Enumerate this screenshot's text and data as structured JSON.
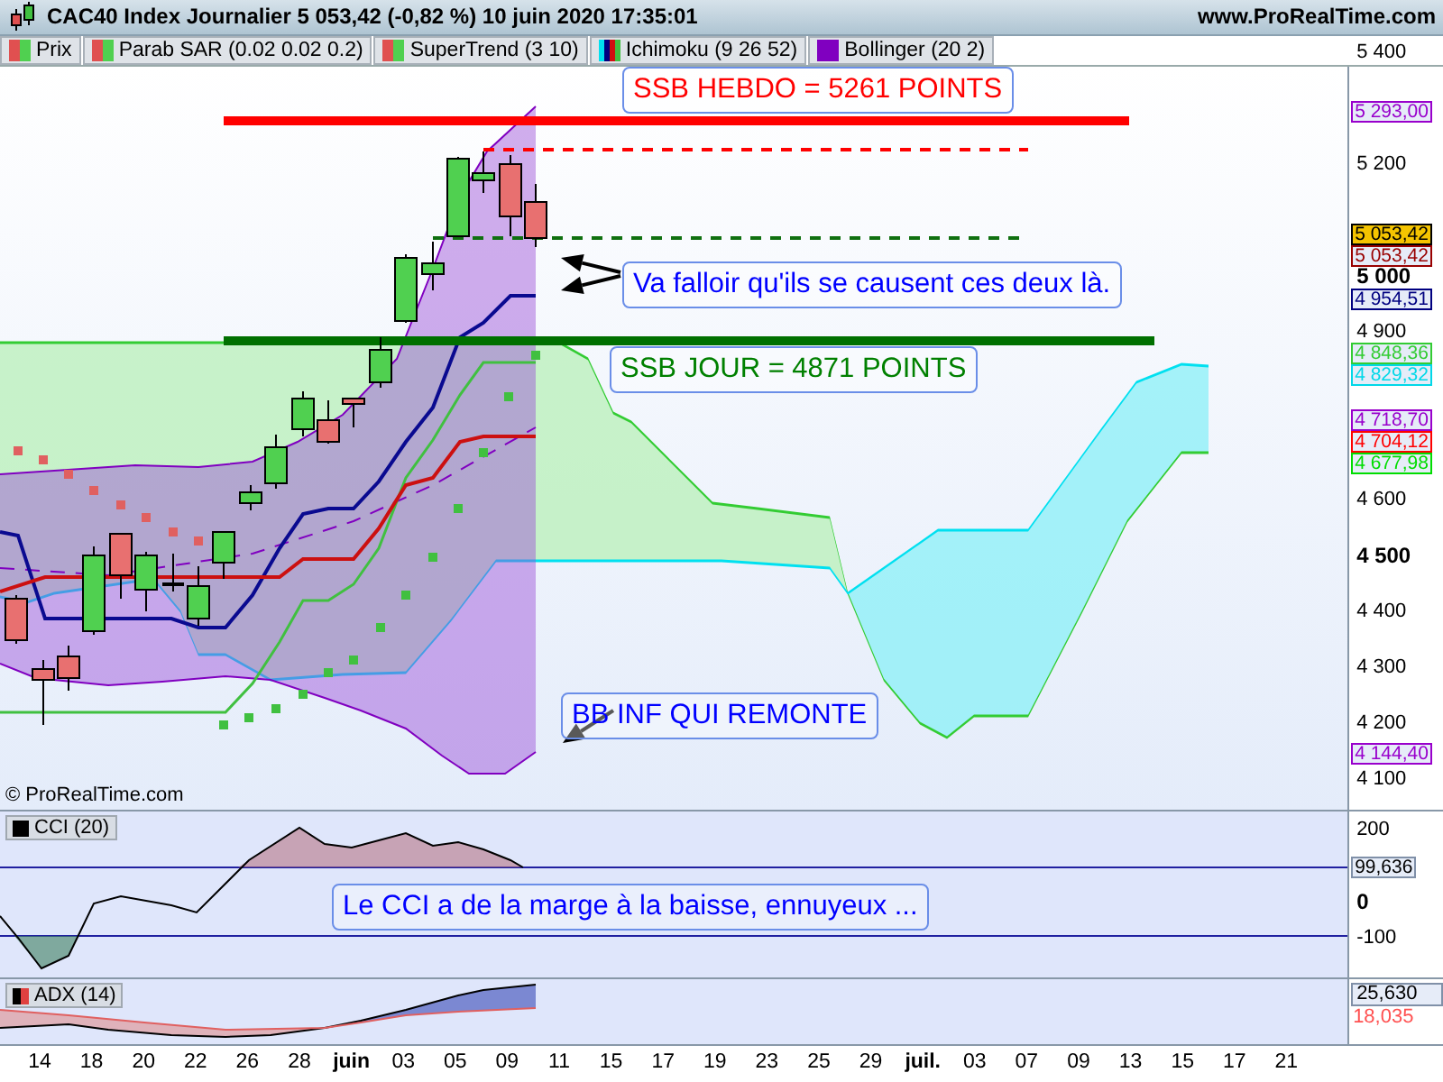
{
  "window": {
    "title": "CAC40 Index Journalier 5 053,42 (-0,82 %) 10 juin 2020 17:35:01",
    "site": "www.ProRealTime.com"
  },
  "legend": [
    {
      "label": "Prix",
      "kind": "two-tone"
    },
    {
      "label": "Parab SAR (0.02 0.02 0.2)",
      "kind": "two-tone"
    },
    {
      "label": "SuperTrend (3 10)",
      "kind": "two-tone"
    },
    {
      "label": "Ichimoku (9 26 52)",
      "kind": "multi"
    },
    {
      "label": "Bollinger (20 2)",
      "kind": "solid"
    }
  ],
  "price_chart": {
    "axis_ticks": [
      {
        "label": "5 400",
        "kind": "plain"
      },
      {
        "label": "5 200",
        "kind": "plain"
      },
      {
        "label": "5 000",
        "kind": "major"
      },
      {
        "label": "4 900",
        "kind": "plain"
      },
      {
        "label": "4 600",
        "kind": "plain"
      },
      {
        "label": "4 500",
        "kind": "major"
      },
      {
        "label": "4 400",
        "kind": "plain"
      },
      {
        "label": "4 300",
        "kind": "plain"
      },
      {
        "label": "4 200",
        "kind": "plain"
      },
      {
        "label": "4 100",
        "kind": "plain"
      }
    ],
    "price_labels": [
      {
        "label": "5 293,00",
        "color": "#9900cc",
        "kind": "plain"
      },
      {
        "label": "5 053,42",
        "color": "#000000",
        "kind": "current"
      },
      {
        "label": "5 053,42",
        "color": "#990000",
        "kind": "plain"
      },
      {
        "label": "4 954,51",
        "color": "#000080",
        "kind": "plain"
      },
      {
        "label": "4 848,36",
        "color": "#33cc33",
        "kind": "plain"
      },
      {
        "label": "4 829,32",
        "color": "#00d8e8",
        "kind": "plain"
      },
      {
        "label": "4 718,70",
        "color": "#9900cc",
        "kind": "plain"
      },
      {
        "label": "4 704,12",
        "color": "#ff0000",
        "kind": "plain"
      },
      {
        "label": "4 677,98",
        "color": "#00dd00",
        "kind": "plain"
      },
      {
        "label": "4 144,40",
        "color": "#9900cc",
        "kind": "plain"
      }
    ],
    "annotations": [
      {
        "text": "SSB HEBDO = 5261 POINTS",
        "color": "#ff0000"
      },
      {
        "text": "Va falloir qu'ils se causent ces deux là.",
        "color": "#0000ff"
      },
      {
        "text": "SSB JOUR = 4871 POINTS",
        "color": "#008000"
      },
      {
        "text": "BB INF QUI REMONTE",
        "color": "#0000ff"
      }
    ],
    "copyright": "© ProRealTime.com"
  },
  "cci_panel": {
    "label": "CCI (20)",
    "axis_ticks": [
      {
        "label": "200",
        "kind": "plain"
      },
      {
        "label": "0",
        "kind": "major"
      },
      {
        "label": "-100",
        "kind": "plain"
      }
    ],
    "value_label": "99,636",
    "annotation": {
      "text": "Le CCI  a de la marge à la baisse, ennuyeux ...",
      "color": "#0000ff"
    }
  },
  "adx_panel": {
    "label": "ADX (14)",
    "value_labels": [
      {
        "label": "25,630",
        "color": "#000000"
      },
      {
        "label": "18,035",
        "color": "#ff5050"
      }
    ]
  },
  "x_axis": [
    {
      "label": "14",
      "kind": "day"
    },
    {
      "label": "18",
      "kind": "day"
    },
    {
      "label": "20",
      "kind": "day"
    },
    {
      "label": "22",
      "kind": "day"
    },
    {
      "label": "26",
      "kind": "day"
    },
    {
      "label": "28",
      "kind": "day"
    },
    {
      "label": "juin",
      "kind": "month"
    },
    {
      "label": "03",
      "kind": "day"
    },
    {
      "label": "05",
      "kind": "day"
    },
    {
      "label": "09",
      "kind": "day"
    },
    {
      "label": "11",
      "kind": "day"
    },
    {
      "label": "15",
      "kind": "day"
    },
    {
      "label": "17",
      "kind": "day"
    },
    {
      "label": "19",
      "kind": "day"
    },
    {
      "label": "23",
      "kind": "day"
    },
    {
      "label": "25",
      "kind": "day"
    },
    {
      "label": "29",
      "kind": "day"
    },
    {
      "label": "juil.",
      "kind": "month"
    },
    {
      "label": "03",
      "kind": "day"
    },
    {
      "label": "07",
      "kind": "day"
    },
    {
      "label": "09",
      "kind": "day"
    },
    {
      "label": "13",
      "kind": "day"
    },
    {
      "label": "15",
      "kind": "day"
    },
    {
      "label": "17",
      "kind": "day"
    },
    {
      "label": "21",
      "kind": "day"
    }
  ]
}
